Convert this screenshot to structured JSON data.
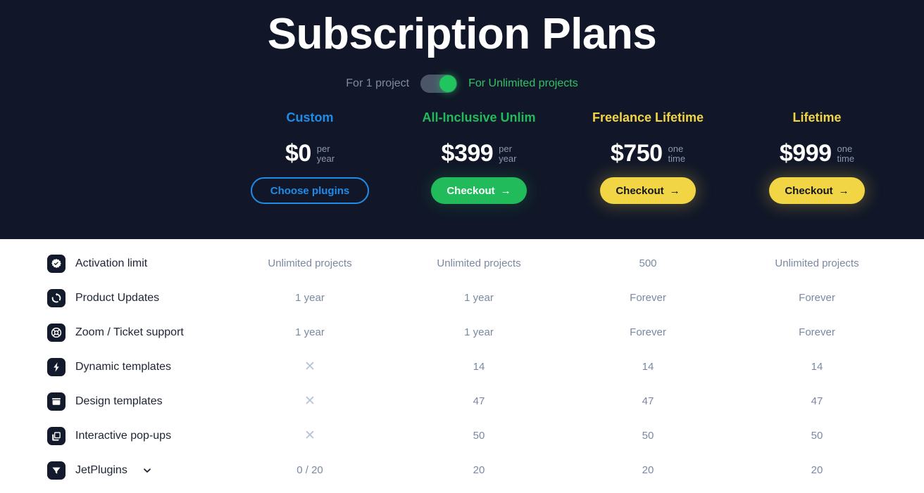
{
  "header": {
    "title": "Subscription Plans",
    "toggle": {
      "left_label": "For 1 project",
      "right_label": "For Unlimited projects",
      "state": "right",
      "track_color": "#4a5568",
      "knob_color": "#20c55e"
    }
  },
  "plans": [
    {
      "name": "Custom",
      "name_color": "#1e8ce8",
      "amount": "$0",
      "period_line1": "per",
      "period_line2": "year",
      "button_label": "Choose plugins",
      "button_style": "outline-blue",
      "button_arrow": ""
    },
    {
      "name": "All-Inclusive Unlim",
      "name_color": "#22bb5b",
      "amount": "$399",
      "period_line1": "per",
      "period_line2": "year",
      "button_label": "Checkout",
      "button_style": "green",
      "button_arrow": "→"
    },
    {
      "name": "Freelance Lifetime",
      "name_color": "#f2d544",
      "amount": "$750",
      "period_line1": "one",
      "period_line2": "time",
      "button_label": "Checkout",
      "button_style": "yellow",
      "button_arrow": "→"
    },
    {
      "name": "Lifetime",
      "name_color": "#f2d544",
      "amount": "$999",
      "period_line1": "one",
      "period_line2": "time",
      "button_label": "Checkout",
      "button_style": "yellow",
      "button_arrow": "→"
    }
  ],
  "features": [
    {
      "label": "Activation limit",
      "icon": "verified-badge-icon",
      "has_chevron": false,
      "values": [
        "Unlimited projects",
        "Unlimited projects",
        "500",
        "Unlimited projects"
      ]
    },
    {
      "label": "Product Updates",
      "icon": "refresh-icon",
      "has_chevron": false,
      "values": [
        "1 year",
        "1 year",
        "Forever",
        "Forever"
      ]
    },
    {
      "label": "Zoom / Ticket support",
      "icon": "lifebuoy-icon",
      "has_chevron": false,
      "values": [
        "1 year",
        "1 year",
        "Forever",
        "Forever"
      ]
    },
    {
      "label": "Dynamic templates",
      "icon": "lightning-bolt-icon",
      "has_chevron": false,
      "values": [
        "✕",
        "14",
        "14",
        "14"
      ]
    },
    {
      "label": "Design templates",
      "icon": "folder-icon",
      "has_chevron": false,
      "values": [
        "✕",
        "47",
        "47",
        "47"
      ]
    },
    {
      "label": "Interactive pop-ups",
      "icon": "windows-stack-icon",
      "has_chevron": false,
      "values": [
        "✕",
        "50",
        "50",
        "50"
      ]
    },
    {
      "label": "JetPlugins",
      "icon": "funnel-icon",
      "has_chevron": true,
      "values": [
        "0 / 20",
        "20",
        "20",
        "20"
      ]
    }
  ],
  "theme": {
    "hero_bg": "#111728",
    "table_bg": "#ffffff",
    "cell_text": "#7b88a1",
    "x_mark": "#b9c4d6",
    "feature_label": "#1d2433",
    "icon_bg": "#131a2c"
  }
}
